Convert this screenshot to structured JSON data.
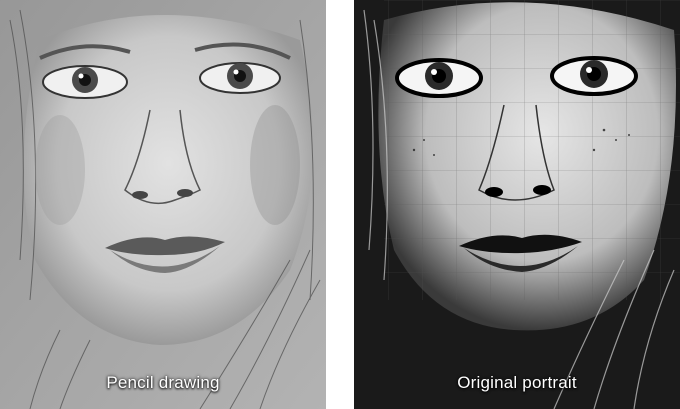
{
  "panels": [
    {
      "caption": "Pencil drawing",
      "style": "graphite sketch"
    },
    {
      "caption": "Original portrait",
      "style": "high-contrast black-and-white photo with grid"
    }
  ],
  "colors": {
    "sketch_paper": "#cfcfcf",
    "sketch_line": "#3a3a3a",
    "photo_light": "#d9d9d9",
    "photo_dark": "#111111",
    "caption_text": "#ffffff",
    "divider": "#ffffff"
  }
}
